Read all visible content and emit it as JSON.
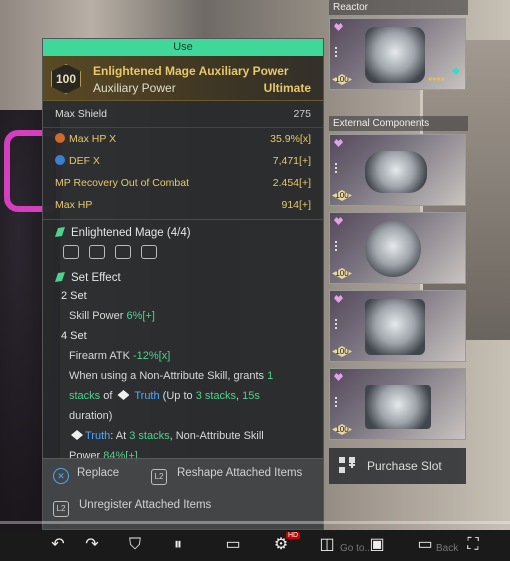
{
  "popup": {
    "use_label": "Use",
    "level": "100",
    "name": "Enlightened Mage Auxiliary Power",
    "type": "Auxiliary Power",
    "grade": "Ultimate",
    "main_stat": {
      "label": "Max Shield",
      "value": "275"
    },
    "sub_stats": [
      {
        "label": "Max HP X",
        "value": "35.9%[x]",
        "icon": "hp-icon"
      },
      {
        "label": "DEF X",
        "value": "7,471[+]",
        "icon": "def-icon"
      },
      {
        "label": "MP Recovery Out of Combat",
        "value": "2.454[+]"
      },
      {
        "label": "Max HP",
        "value": "914[+]"
      }
    ],
    "set_name": "Enlightened Mage (4/4)",
    "set_effect_title": "Set Effect",
    "set2": {
      "title": "2 Set",
      "line_pre": "Skill Power ",
      "line_val": "6%[+]"
    },
    "set4": {
      "title": "4 Set",
      "l1_pre": "Firearm ATK ",
      "l1_val": "-12%[x]",
      "l2a": "When using a Non-Attribute Skill, grants ",
      "l2b": "1",
      "l3a": "stacks",
      "l3b": " of ",
      "l3c": "Truth",
      "l3d": " (Up to ",
      "l3e": "3 stacks",
      "l3f": ", ",
      "l3g": "15s",
      "l4": "duration)",
      "l5a": "Truth",
      "l5b": ": At ",
      "l5c": "3 stacks",
      "l5d": ", Non-Attribute Skill",
      "l6a": "Power ",
      "l6b": "84%[+]"
    },
    "actions": {
      "replace": "Replace",
      "reshape": "Reshape Attached Items",
      "unregister": "Unregister Attached Items"
    }
  },
  "right_panel": {
    "reactor_label": "Reactor",
    "external_label": "External Components",
    "slot_level": "100",
    "purchase_label": "Purchase Slot"
  },
  "player": {
    "progress_percent": 0,
    "faint_1": "Go to...",
    "faint_2": "Back",
    "hd_badge": "HD"
  },
  "colors": {
    "use_bar": "#3fd89a",
    "gold": "#e8c86a",
    "green": "#4ed28c",
    "blue": "#4aa8ff"
  }
}
